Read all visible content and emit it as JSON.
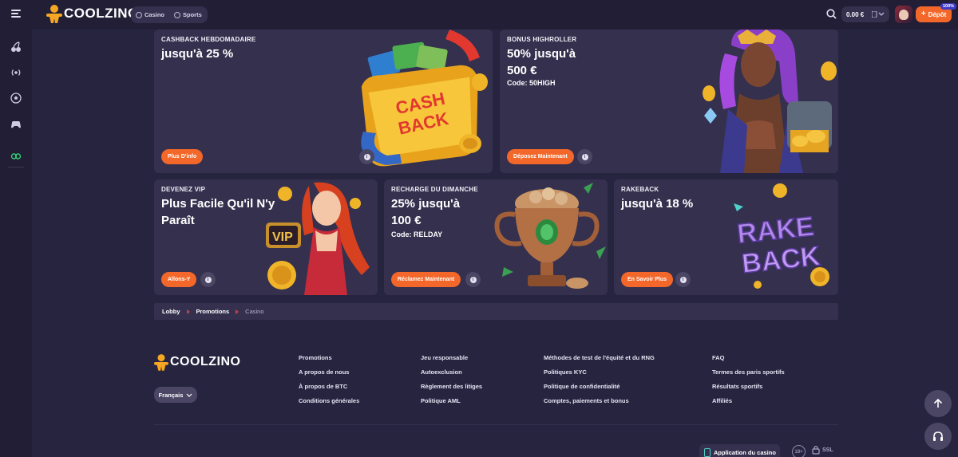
{
  "header": {
    "logo_text": "COOLZINO",
    "modes": [
      {
        "label": "Casino",
        "icon": "casino-icon"
      },
      {
        "label": "Sports",
        "icon": "sports-ball-icon"
      }
    ],
    "balance": "0.00 €",
    "deposit_label": "Dépôt",
    "deposit_badge": "100%"
  },
  "sidebar": {
    "icons": [
      "cherries-icon",
      "live-broadcast-icon",
      "football-icon",
      "gamepad-icon",
      "loyalty-icon"
    ]
  },
  "promos": [
    {
      "label": "CASHBACK HEBDOMADAIRE",
      "title": "jusqu'à 25 %",
      "code": "",
      "button": "Plus D'info"
    },
    {
      "label": "BONUS HIGHROLLER",
      "title": "50% jusqu'à 500 €",
      "code": "Code: 50HIGH",
      "button": "Déposez Maintenant"
    },
    {
      "label": "DEVENEZ VIP",
      "title": "Plus Facile Qu'il N'y Paraît",
      "code": "",
      "button": "Allons-Y"
    },
    {
      "label": "RECHARGE DU DIMANCHE",
      "title": "25% jusqu'à 100 €",
      "code": "Code: RELDAY",
      "button": "Réclamez Maintenant"
    },
    {
      "label": "RAKEBACK",
      "title": "jusqu'à 18 %",
      "code": "",
      "button": "En Savoir Plus"
    }
  ],
  "art_text": {
    "cashback": "CASH BACK",
    "vip": "VIP",
    "rakeback": "RAKE BACK"
  },
  "breadcrumb": [
    "Lobby",
    "Promotions",
    "Casino"
  ],
  "footer": {
    "logo_text": "COOLZINO",
    "language": "Français",
    "columns": [
      [
        "Promotions",
        "A propos de nous",
        "À propos de BTC",
        "Conditions générales"
      ],
      [
        "Jeu responsable",
        "Autoexclusion",
        "Règlement des litiges",
        "Politique AML"
      ],
      [
        "Méthodes de test de l'équité et du RNG",
        "Politiques KYC",
        "Politique de confidentialité",
        "Comptes, paiements et bonus"
      ],
      [
        "FAQ",
        "Termes des paris sportifs",
        "Résultats sportifs",
        "Affiliés"
      ]
    ],
    "app_label": "Application du casino",
    "age_label": "18+",
    "ssl_label": "SSL"
  }
}
